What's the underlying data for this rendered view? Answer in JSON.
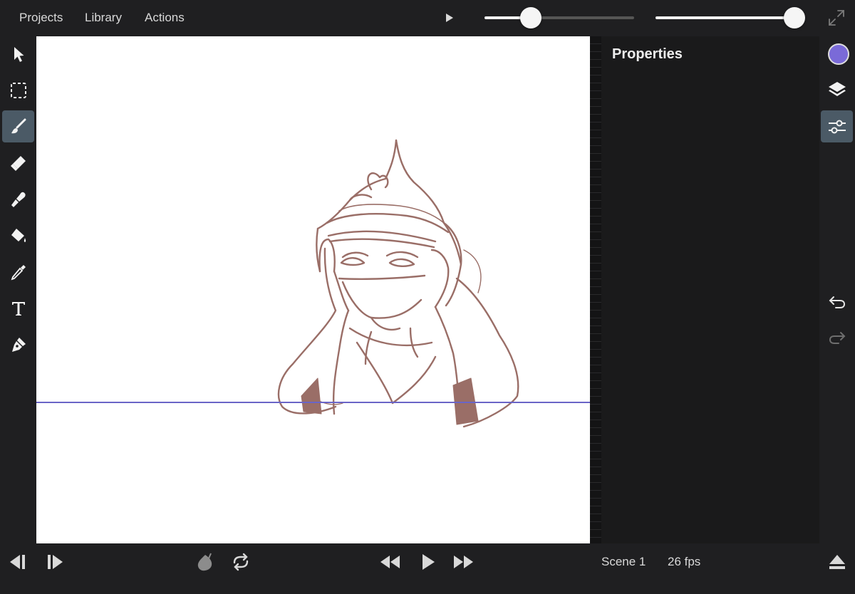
{
  "menu": {
    "projects": "Projects",
    "library": "Library",
    "actions": "Actions"
  },
  "top_controls": {
    "slider_1_value": 0.31,
    "slider_2_value": 0.93
  },
  "tools": [
    {
      "name": "select",
      "icon": "arrow-cursor-icon"
    },
    {
      "name": "marquee",
      "icon": "dashed-rect-icon"
    },
    {
      "name": "brush",
      "icon": "brush-icon",
      "active": true
    },
    {
      "name": "eraser",
      "icon": "eraser-icon"
    },
    {
      "name": "smudge",
      "icon": "smudge-icon"
    },
    {
      "name": "fill",
      "icon": "paint-bucket-icon"
    },
    {
      "name": "eyedropper",
      "icon": "eyedropper-icon"
    },
    {
      "name": "text",
      "icon": "text-icon"
    },
    {
      "name": "pen",
      "icon": "pen-nib-icon"
    }
  ],
  "properties": {
    "title": "Properties"
  },
  "right_tools": {
    "current_color": "#7a6ad8",
    "active": "adjustments"
  },
  "status": {
    "scene": "Scene 1",
    "fps": "26 fps"
  },
  "colors": {
    "accent": "#4b5a66",
    "guide": "#6a65c7",
    "sketch": "#9a6e67"
  }
}
